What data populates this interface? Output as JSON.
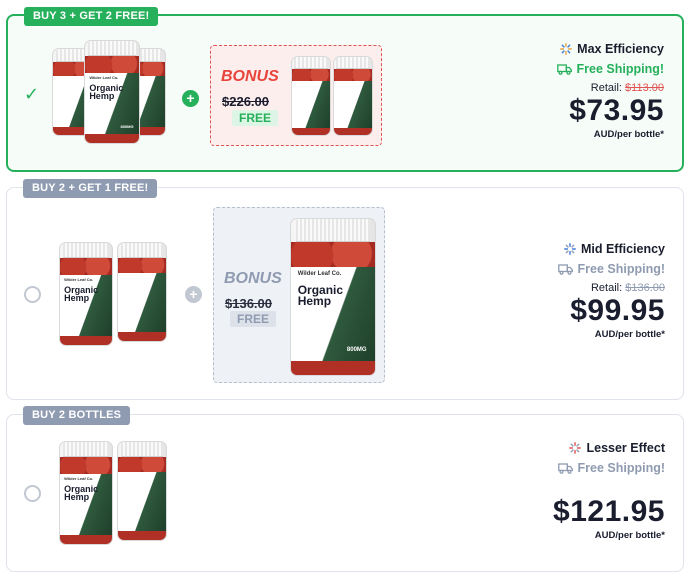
{
  "offers": [
    {
      "tag": "BUY 3 + GET 2 FREE!",
      "selected": true,
      "main_bottles": 3,
      "bonus": {
        "word": "BONUS",
        "original_price": "$226.00",
        "free": "FREE",
        "bottles": 2
      },
      "efficiency": "Max Efficiency",
      "shipping": "Free Shipping!",
      "retail_label": "Retail:",
      "retail_price": "$113.00",
      "price": "$73.95",
      "per": "AUD/per bottle*"
    },
    {
      "tag": "BUY 2 + GET 1 FREE!",
      "selected": false,
      "main_bottles": 2,
      "bonus": {
        "word": "BONUS",
        "original_price": "$136.00",
        "free": "FREE",
        "bottles": 1
      },
      "efficiency": "Mid Efficiency",
      "shipping": "Free Shipping!",
      "retail_label": "Retail:",
      "retail_price": "$136.00",
      "price": "$99.95",
      "per": "AUD/per bottle*"
    },
    {
      "tag": "BUY 2 BOTTLES",
      "selected": false,
      "main_bottles": 2,
      "efficiency": "Lesser Effect",
      "shipping": "Free Shipping!",
      "price": "$121.95",
      "per": "AUD/per bottle*"
    }
  ],
  "product": {
    "brand": "Wilder Leaf Co.",
    "name_line1": "Organic",
    "name_line2": "Hemp",
    "strength": "800MG"
  },
  "colors": {
    "accent_green": "#27b05b",
    "muted_gray": "#8f9bb0",
    "bonus_red": "#e8443c",
    "strike_red": "#e05353"
  },
  "icons": {
    "selected": "check-icon",
    "efficiency": "sparkle-icon",
    "shipping": "truck-icon",
    "add": "plus-icon"
  }
}
